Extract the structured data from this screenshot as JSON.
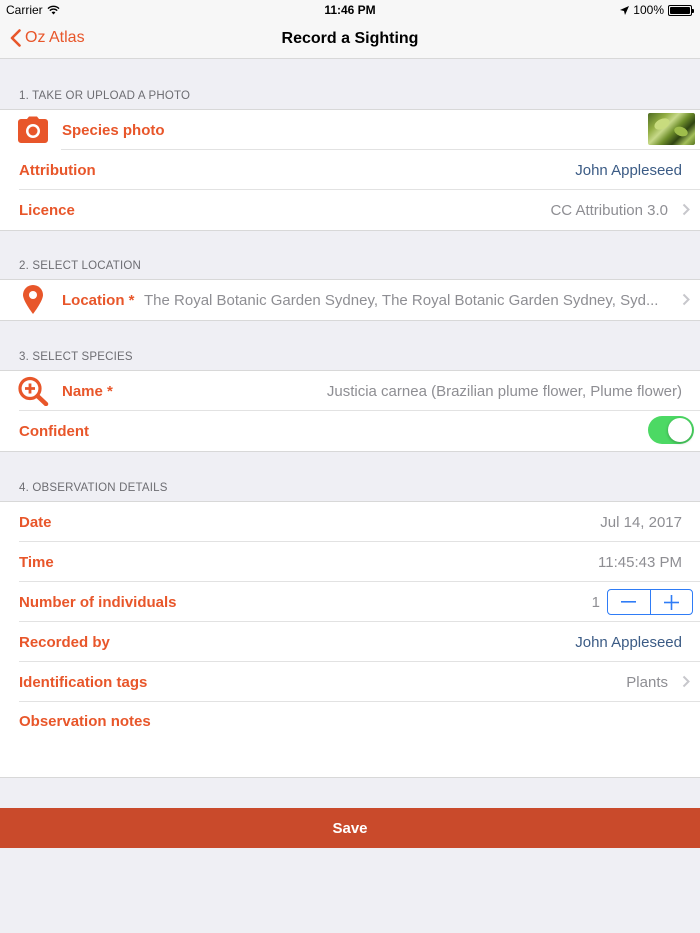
{
  "status_bar": {
    "carrier": "Carrier",
    "time": "11:46 PM",
    "battery": "100%"
  },
  "nav": {
    "back_label": "Oz Atlas",
    "title": "Record a Sighting"
  },
  "sections": {
    "photo": {
      "header": "1. TAKE OR UPLOAD A PHOTO",
      "species_photo_label": "Species photo",
      "attribution_label": "Attribution",
      "attribution_value": "John Appleseed",
      "licence_label": "Licence",
      "licence_value": "CC Attribution 3.0"
    },
    "location": {
      "header": "2. SELECT LOCATION",
      "label": "Location *",
      "value": "The Royal Botanic Garden Sydney, The Royal Botanic Garden Sydney, Syd..."
    },
    "species": {
      "header": "3. SELECT SPECIES",
      "name_label": "Name *",
      "name_value": "Justicia carnea (Brazilian plume flower, Plume flower)",
      "confident_label": "Confident",
      "confident_on": true
    },
    "details": {
      "header": "4. OBSERVATION DETAILS",
      "date_label": "Date",
      "date_value": "Jul 14, 2017",
      "time_label": "Time",
      "time_value": "11:45:43 PM",
      "individuals_label": "Number of individuals",
      "individuals_value": "1",
      "recorded_by_label": "Recorded by",
      "recorded_by_value": "John Appleseed",
      "tags_label": "Identification tags",
      "tags_value": "Plants",
      "notes_label": "Observation notes"
    }
  },
  "save_label": "Save",
  "colors": {
    "accent": "#e8562a",
    "save_bg": "#c94a2b",
    "link_blue": "#3b5b85",
    "toggle_on": "#4cd964",
    "stepper_blue": "#2f7cf6"
  },
  "icons": [
    "camera-icon",
    "location-pin-icon",
    "search-plus-icon",
    "chevron-right-icon",
    "chevron-left-icon",
    "wifi-icon",
    "location-arrow-icon",
    "battery-icon",
    "minus-icon",
    "plus-icon"
  ]
}
